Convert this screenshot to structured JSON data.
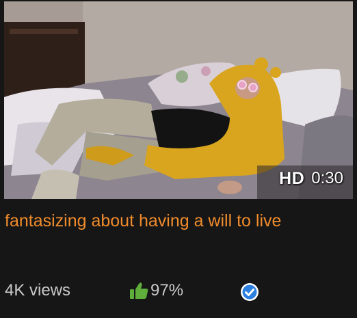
{
  "video": {
    "badge": {
      "hd": "HD",
      "duration": "0:30"
    },
    "title": "fantasizing about having a will to live",
    "views": "4K views",
    "rating": "97%"
  },
  "icons": {
    "rating": "thumbs-up-icon",
    "verified": "verified-checkmark-icon"
  },
  "colors": {
    "background": "#161616",
    "title": "#ef8b2c",
    "meta_text": "#c9c9c9",
    "thumbs_up": "#5fae3b",
    "verified": "#2d7fe0"
  }
}
